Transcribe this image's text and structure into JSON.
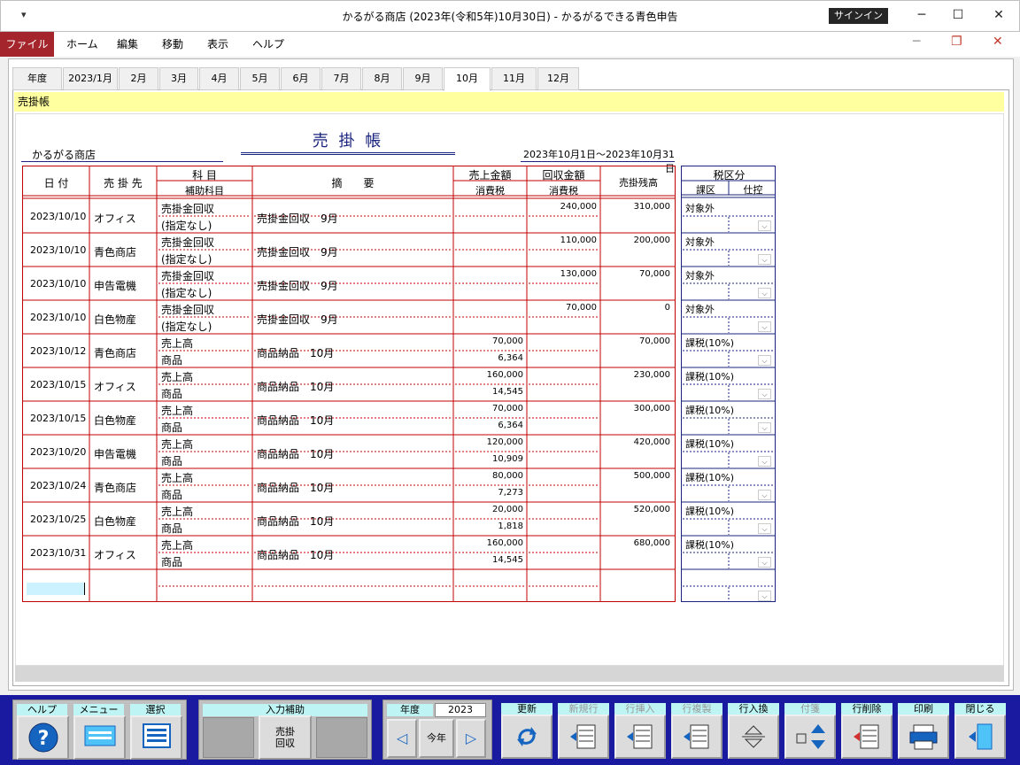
{
  "window": {
    "title": "かるがる商店 (2023年(令和5年)10月30日)  -  かるがるできる青色申告",
    "signin": "サインイン",
    "quick_access": "▾",
    "min": "─",
    "max": "☐",
    "close": "✕"
  },
  "menu": {
    "file": "ファイル",
    "items": [
      "ホーム",
      "編集",
      "移動",
      "表示",
      "ヘルプ"
    ]
  },
  "tabs": [
    "年度",
    "2023/1月",
    "2月",
    "3月",
    "4月",
    "5月",
    "6月",
    "7月",
    "8月",
    "9月",
    "10月",
    "11月",
    "12月"
  ],
  "selected_tab": "10月",
  "section_label": "売掛帳",
  "ledger": {
    "title": "売 掛 帳",
    "shop": "かるがる商店",
    "period": "2023年10月1日～2023年10月31日",
    "headers": {
      "date": "日 付",
      "customer": "売 掛 先",
      "account": "科 目",
      "sub_account": "補助科目",
      "summary": "摘　　要",
      "sales": "売上金額",
      "sales_tax": "消費税",
      "collect": "回収金額",
      "collect_tax": "消費税",
      "balance": "売掛残高"
    },
    "tax_headers": {
      "title": "税区分",
      "sub1": "課区",
      "sub2": "仕控"
    },
    "rows": [
      {
        "date": "2023/10/10",
        "customer": "オフィス",
        "account": "売掛金回収",
        "sub": "(指定なし)",
        "summary": "売掛金回収　9月",
        "sales": "",
        "tax": "",
        "collect": "240,000",
        "balance": "310,000",
        "taxcat": "対象外"
      },
      {
        "date": "2023/10/10",
        "customer": "青色商店",
        "account": "売掛金回収",
        "sub": "(指定なし)",
        "summary": "売掛金回収　9月",
        "sales": "",
        "tax": "",
        "collect": "110,000",
        "balance": "200,000",
        "taxcat": "対象外"
      },
      {
        "date": "2023/10/10",
        "customer": "申告電機",
        "account": "売掛金回収",
        "sub": "(指定なし)",
        "summary": "売掛金回収　9月",
        "sales": "",
        "tax": "",
        "collect": "130,000",
        "balance": "70,000",
        "taxcat": "対象外"
      },
      {
        "date": "2023/10/10",
        "customer": "白色物産",
        "account": "売掛金回収",
        "sub": "(指定なし)",
        "summary": "売掛金回収　9月",
        "sales": "",
        "tax": "",
        "collect": "70,000",
        "balance": "0",
        "taxcat": "対象外"
      },
      {
        "date": "2023/10/12",
        "customer": "青色商店",
        "account": "売上高",
        "sub": "商品",
        "summary": "商品納品　10月",
        "sales": "70,000",
        "tax": "6,364",
        "collect": "",
        "balance": "70,000",
        "taxcat": "課税(10%)"
      },
      {
        "date": "2023/10/15",
        "customer": "オフィス",
        "account": "売上高",
        "sub": "商品",
        "summary": "商品納品　10月",
        "sales": "160,000",
        "tax": "14,545",
        "collect": "",
        "balance": "230,000",
        "taxcat": "課税(10%)"
      },
      {
        "date": "2023/10/15",
        "customer": "白色物産",
        "account": "売上高",
        "sub": "商品",
        "summary": "商品納品　10月",
        "sales": "70,000",
        "tax": "6,364",
        "collect": "",
        "balance": "300,000",
        "taxcat": "課税(10%)"
      },
      {
        "date": "2023/10/20",
        "customer": "申告電機",
        "account": "売上高",
        "sub": "商品",
        "summary": "商品納品　10月",
        "sales": "120,000",
        "tax": "10,909",
        "collect": "",
        "balance": "420,000",
        "taxcat": "課税(10%)"
      },
      {
        "date": "2023/10/24",
        "customer": "青色商店",
        "account": "売上高",
        "sub": "商品",
        "summary": "商品納品　10月",
        "sales": "80,000",
        "tax": "7,273",
        "collect": "",
        "balance": "500,000",
        "taxcat": "課税(10%)"
      },
      {
        "date": "2023/10/25",
        "customer": "白色物産",
        "account": "売上高",
        "sub": "商品",
        "summary": "商品納品　10月",
        "sales": "20,000",
        "tax": "1,818",
        "collect": "",
        "balance": "520,000",
        "taxcat": "課税(10%)"
      },
      {
        "date": "2023/10/31",
        "customer": "オフィス",
        "account": "売上高",
        "sub": "商品",
        "summary": "商品納品　10月",
        "sales": "160,000",
        "tax": "14,545",
        "collect": "",
        "balance": "680,000",
        "taxcat": "課税(10%)"
      }
    ]
  },
  "toolbar": {
    "help": "ヘルプ",
    "menu": "メニュー",
    "select": "選択",
    "input_assist": "入力補助",
    "assist_btn": "売掛\n回収",
    "year_label": "年度",
    "year_value": "2023",
    "this_year": "今年",
    "update": "更新",
    "new_row": "新規行",
    "insert_row": "行挿入",
    "copy_row": "行複製",
    "swap_row": "行入換",
    "tag": "付箋",
    "delete_row": "行削除",
    "print": "印刷",
    "close": "閉じる"
  },
  "colors": {
    "accent": "#a4262c",
    "toolbar_bg": "#1a1aa0",
    "ledger_border": "#c00000",
    "tax_border": "#1a237e"
  }
}
